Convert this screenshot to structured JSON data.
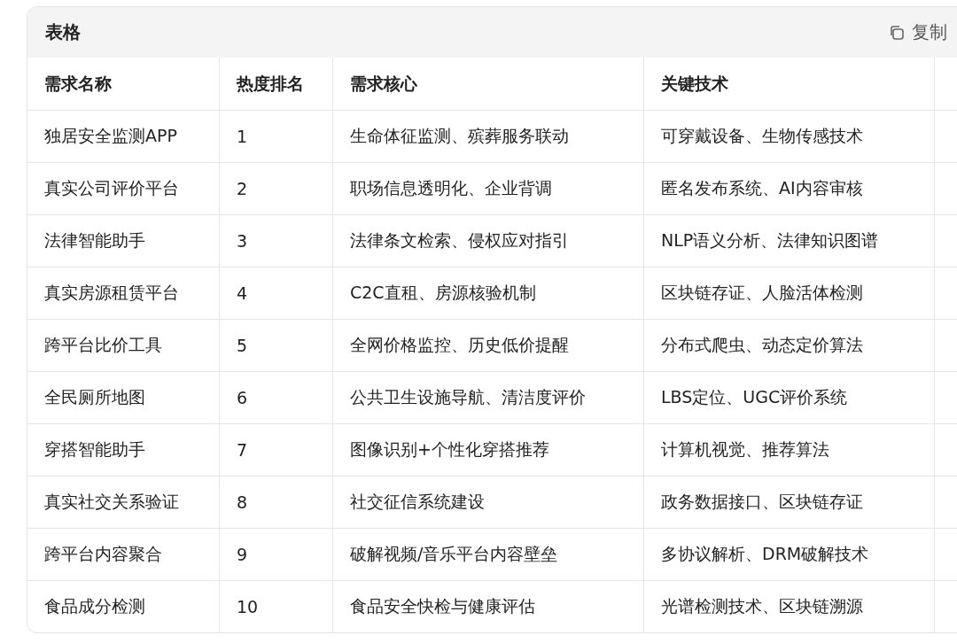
{
  "panel": {
    "title": "表格",
    "copy_button": "复制"
  },
  "table": {
    "columns": [
      "需求名称",
      "热度排名",
      "需求核心",
      "关键技术"
    ],
    "rows": [
      [
        "独居安全监测APP",
        "1",
        "生命体征监测、殡葬服务联动",
        "可穿戴设备、生物传感技术"
      ],
      [
        "真实公司评价平台",
        "2",
        "职场信息透明化、企业背调",
        "匿名发布系统、AI内容审核"
      ],
      [
        "法律智能助手",
        "3",
        "法律条文检索、侵权应对指引",
        "NLP语义分析、法律知识图谱"
      ],
      [
        "真实房源租赁平台",
        "4",
        "C2C直租、房源核验机制",
        "区块链存证、人脸活体检测"
      ],
      [
        "跨平台比价工具",
        "5",
        "全网价格监控、历史低价提醒",
        "分布式爬虫、动态定价算法"
      ],
      [
        "全民厕所地图",
        "6",
        "公共卫生设施导航、清洁度评价",
        "LBS定位、UGC评价系统"
      ],
      [
        "穿搭智能助手",
        "7",
        "图像识别+个性化穿搭推荐",
        "计算机视觉、推荐算法"
      ],
      [
        "真实社交关系验证",
        "8",
        "社交征信系统建设",
        "政务数据接口、区块链存证"
      ],
      [
        "跨平台内容聚合",
        "9",
        "破解视频/音乐平台内容壁垒",
        "多协议解析、DRM破解技术"
      ],
      [
        "食品成分检测",
        "10",
        "食品安全快检与健康评估",
        "光谱检测技术、区块链溯源"
      ]
    ]
  }
}
